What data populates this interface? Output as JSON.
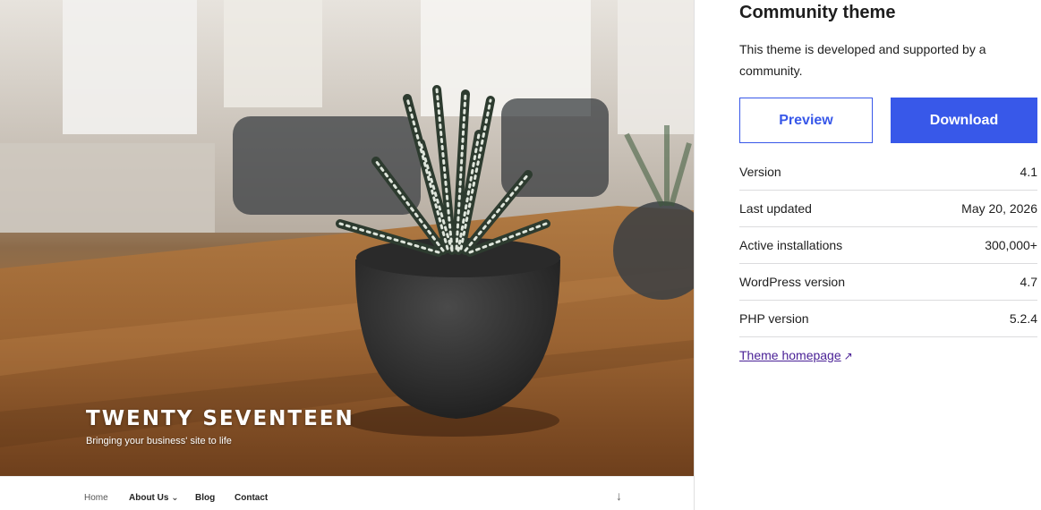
{
  "theme_preview": {
    "site_title": "TWENTY SEVENTEEN",
    "site_tagline": "Bringing your business' site to life",
    "nav": {
      "home": "Home",
      "about": "About Us",
      "about_chevron": "⌄",
      "blog": "Blog",
      "contact": "Contact",
      "scroll_arrow": "↓"
    }
  },
  "sidebar": {
    "heading": "Community theme",
    "description": "This theme is developed and supported by a community.",
    "preview_label": "Preview",
    "download_label": "Download",
    "meta": [
      {
        "key": "Version",
        "value": "4.1"
      },
      {
        "key": "Last updated",
        "value": "May 20, 2026"
      },
      {
        "key": "Active installations",
        "value": "300,000+"
      },
      {
        "key": "WordPress version",
        "value": "4.7"
      },
      {
        "key": "PHP version",
        "value": "5.2.4"
      }
    ],
    "homepage_link": "Theme homepage",
    "homepage_icon": "↗"
  },
  "colors": {
    "accent": "#3858e9",
    "link_visited": "#4a2196",
    "divider": "#dcdcde"
  },
  "icons": {
    "external_link": "external-link-icon",
    "chevron": "chevron-down-icon",
    "scroll_down": "arrow-down-icon"
  }
}
